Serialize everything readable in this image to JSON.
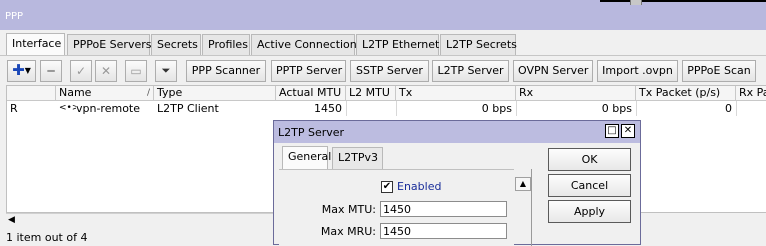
{
  "window": {
    "title": "PPP"
  },
  "tabs": [
    "Interface",
    "PPPoE Servers",
    "Secrets",
    "Profiles",
    "Active Connections",
    "L2TP Ethernet",
    "L2TP Secrets"
  ],
  "toolbar": {
    "buttons": [
      "PPP Scanner",
      "PPTP Server",
      "SSTP Server",
      "L2TP Server",
      "OVPN Server",
      "Import .ovpn",
      "PPPoE Scan"
    ],
    "add_icon": "plus-icon",
    "filter_icon": "funnel-icon"
  },
  "table": {
    "columns": [
      "",
      "Name",
      "Type",
      "Actual MTU",
      "L2 MTU",
      "Tx",
      "Rx",
      "Tx Packet (p/s)",
      "Rx Pac"
    ],
    "rows": [
      {
        "flag": "R",
        "icon": "<•>",
        "name": "vpn-remote",
        "type": "L2TP Client",
        "actual_mtu": "1450",
        "l2_mtu": "",
        "tx": "0 bps",
        "rx": "0 bps",
        "tx_packet": "0",
        "rx_packet": ""
      }
    ]
  },
  "status": {
    "text": "1 item out of 4"
  },
  "dialog": {
    "title": "L2TP Server",
    "tabs": [
      "General",
      "L2TPv3"
    ],
    "enabled_label": "Enabled",
    "enabled": true,
    "fields": [
      {
        "label": "Max MTU:",
        "value": "1450"
      },
      {
        "label": "Max MRU:",
        "value": "1450"
      }
    ],
    "buttons": {
      "ok": "OK",
      "cancel": "Cancel",
      "apply": "Apply"
    }
  }
}
